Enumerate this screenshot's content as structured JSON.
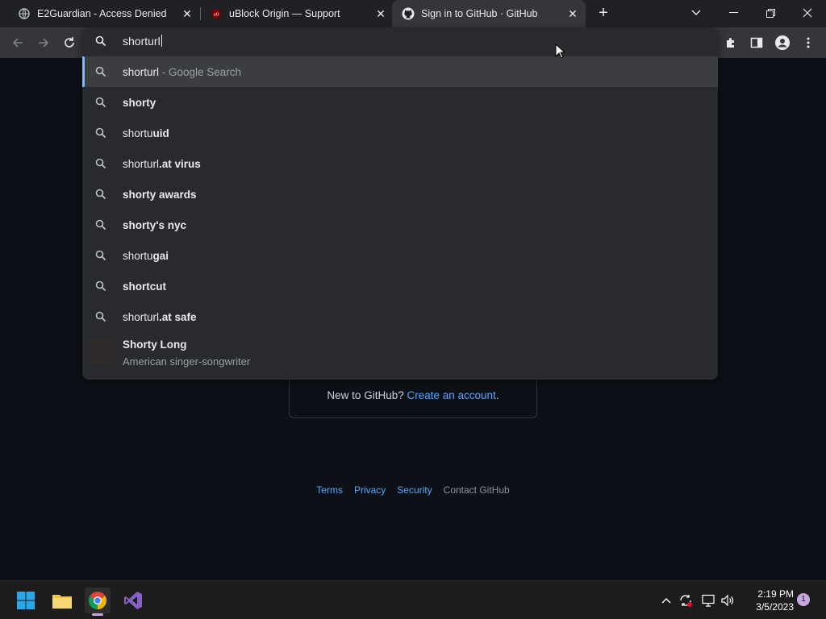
{
  "tabs": [
    {
      "title": "E2Guardian - Access Denied",
      "icon": "globe-icon"
    },
    {
      "title": "uBlock Origin — Support",
      "icon": "ublock-icon"
    },
    {
      "title": "Sign in to GitHub · GitHub",
      "icon": "github-icon",
      "active": true
    }
  ],
  "omnibox": {
    "value": "shorturl",
    "suggestions": [
      {
        "prefix": "shorturl",
        "bold": "",
        "suffix": " - Google Search",
        "selected": true
      },
      {
        "prefix": "",
        "bold": "shorty",
        "suffix": ""
      },
      {
        "prefix": "shortu",
        "bold": "uid",
        "suffix": ""
      },
      {
        "prefix": "shorturl",
        "bold": ".at virus",
        "suffix": ""
      },
      {
        "prefix": "",
        "bold": "shorty awards",
        "suffix": ""
      },
      {
        "prefix": "",
        "bold": "shorty's nyc",
        "suffix": ""
      },
      {
        "prefix": "shortu",
        "bold": "gai",
        "suffix": ""
      },
      {
        "prefix": "",
        "bold": "shortcut",
        "suffix": ""
      },
      {
        "prefix": "shorturl",
        "bold": ".at safe",
        "suffix": ""
      }
    ],
    "entity": {
      "title": "Shorty Long",
      "subtitle": "American singer-songwriter"
    }
  },
  "github": {
    "new_text": "New to GitHub? ",
    "create_link": "Create an account",
    "period": ".",
    "footer": [
      "Terms",
      "Privacy",
      "Security",
      "Contact GitHub"
    ]
  },
  "taskbar": {
    "time": "2:19 PM",
    "date": "3/5/2023",
    "notifications": "1"
  },
  "colors": {
    "accent": "#8ab4f8",
    "link": "#58a6ff"
  }
}
